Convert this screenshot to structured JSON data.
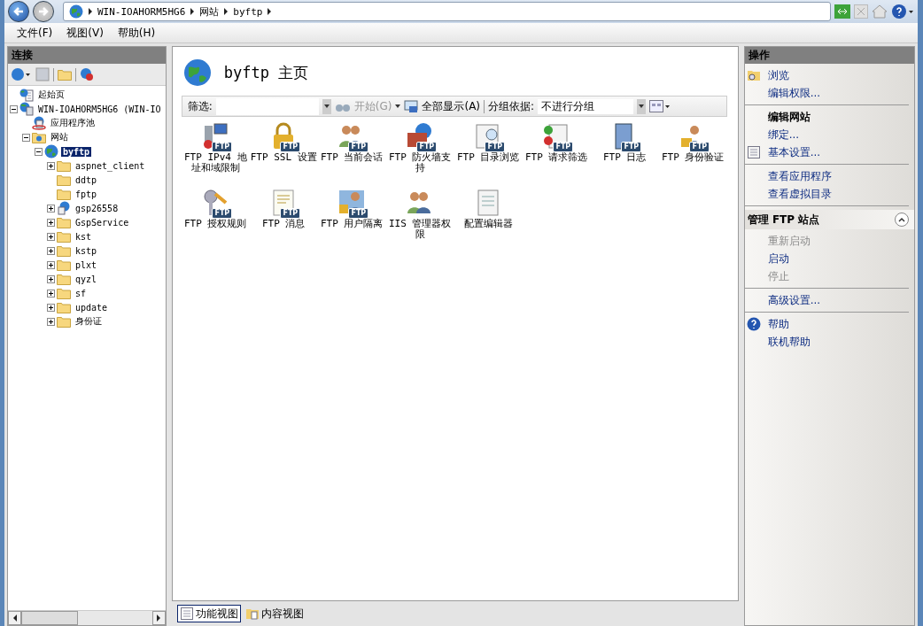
{
  "nav": {
    "breadcrumb": [
      "WIN-IOAHORM5HG6",
      "网站",
      "byftp"
    ]
  },
  "menu": [
    "文件(F)",
    "视图(V)",
    "帮助(H)"
  ],
  "connections": {
    "title": "连接",
    "tree": [
      {
        "label": "起始页",
        "kind": "home",
        "has_children": false,
        "selected": false
      },
      {
        "label": "WIN-IOAHORM5HG6 (WIN-IO",
        "kind": "server",
        "has_children": true,
        "expanded": true,
        "selected": false,
        "children": [
          {
            "label": "应用程序池",
            "kind": "pool",
            "has_children": false,
            "selected": false
          },
          {
            "label": "网站",
            "kind": "sites",
            "has_children": true,
            "expanded": true,
            "selected": false,
            "children": [
              {
                "label": "byftp",
                "kind": "site",
                "has_children": true,
                "expanded": true,
                "selected": true,
                "children": [
                  {
                    "label": "aspnet_client",
                    "kind": "folder",
                    "has_children": true,
                    "expanded": false,
                    "selected": false
                  },
                  {
                    "label": "ddtp",
                    "kind": "folder",
                    "has_children": false,
                    "selected": false
                  },
                  {
                    "label": "fptp",
                    "kind": "folder",
                    "has_children": false,
                    "selected": false
                  },
                  {
                    "label": "gsp26558",
                    "kind": "app",
                    "has_children": true,
                    "expanded": false,
                    "selected": false
                  },
                  {
                    "label": "GspService",
                    "kind": "folder",
                    "has_children": true,
                    "expanded": false,
                    "selected": false
                  },
                  {
                    "label": "kst",
                    "kind": "folder",
                    "has_children": true,
                    "expanded": false,
                    "selected": false
                  },
                  {
                    "label": "kstp",
                    "kind": "folder",
                    "has_children": true,
                    "expanded": false,
                    "selected": false
                  },
                  {
                    "label": "plxt",
                    "kind": "folder",
                    "has_children": true,
                    "expanded": false,
                    "selected": false
                  },
                  {
                    "label": "qyzl",
                    "kind": "folder",
                    "has_children": true,
                    "expanded": false,
                    "selected": false
                  },
                  {
                    "label": "sf",
                    "kind": "folder",
                    "has_children": true,
                    "expanded": false,
                    "selected": false
                  },
                  {
                    "label": "update",
                    "kind": "folder",
                    "has_children": true,
                    "expanded": false,
                    "selected": false
                  },
                  {
                    "label": "身份证",
                    "kind": "folder",
                    "has_children": true,
                    "expanded": false,
                    "selected": false
                  }
                ]
              }
            ]
          }
        ]
      }
    ]
  },
  "main": {
    "title": "byftp 主页",
    "filter": {
      "label": "筛选:",
      "go": "开始(G)",
      "show_all": "全部显示(A)",
      "group_label": "分组依据:",
      "group_value": "不进行分组"
    },
    "features": [
      {
        "label": "FTP IPv4 地址和域限制",
        "kind": "ipv4",
        "badge": "FTP"
      },
      {
        "label": "FTP SSL 设置",
        "kind": "lock",
        "badge": "FTP"
      },
      {
        "label": "FTP 当前会话",
        "kind": "users",
        "badge": "FTP"
      },
      {
        "label": "FTP 防火墙支持",
        "kind": "firewall",
        "badge": "FTP"
      },
      {
        "label": "FTP 目录浏览",
        "kind": "browse",
        "badge": "FTP"
      },
      {
        "label": "FTP 请求筛选",
        "kind": "filter",
        "badge": "FTP"
      },
      {
        "label": "FTP 日志",
        "kind": "log",
        "badge": "FTP"
      },
      {
        "label": "FTP 身份验证",
        "kind": "auth",
        "badge": "FTP"
      },
      {
        "label": "FTP 授权规则",
        "kind": "key",
        "badge": "FTP"
      },
      {
        "label": "FTP 消息",
        "kind": "message",
        "badge": "FTP"
      },
      {
        "label": "FTP 用户隔离",
        "kind": "isolation",
        "badge": "FTP"
      },
      {
        "label": "IIS 管理器权限",
        "kind": "users"
      },
      {
        "label": "配置编辑器",
        "kind": "editor"
      }
    ],
    "view_tabs": [
      {
        "label": "功能视图",
        "selected": true
      },
      {
        "label": "内容视图",
        "selected": false
      }
    ]
  },
  "actions": {
    "title": "操作",
    "sections": [
      {
        "groups": [
          [
            {
              "label": "浏览",
              "kind": "browse",
              "disabled": false
            },
            {
              "label": "编辑权限...",
              "kind": "link",
              "disabled": false
            }
          ],
          [
            {
              "label": "编辑网站",
              "kind": "heading",
              "disabled": false
            },
            {
              "label": "绑定...",
              "kind": "link",
              "disabled": false
            },
            {
              "label": "基本设置...",
              "kind": "settings",
              "disabled": false
            }
          ],
          [
            {
              "label": "查看应用程序",
              "kind": "link",
              "disabled": false
            },
            {
              "label": "查看虚拟目录",
              "kind": "link",
              "disabled": false
            }
          ]
        ]
      },
      {
        "title": "管理 FTP 站点",
        "expanded": true,
        "groups": [
          [
            {
              "label": "重新启动",
              "kind": "link",
              "disabled": true
            },
            {
              "label": "启动",
              "kind": "link",
              "disabled": false
            },
            {
              "label": "停止",
              "kind": "link",
              "disabled": true
            }
          ],
          [
            {
              "label": "高级设置...",
              "kind": "link",
              "disabled": false
            }
          ],
          [
            {
              "label": "帮助",
              "kind": "help",
              "disabled": false
            },
            {
              "label": "联机帮助",
              "kind": "link",
              "disabled": false
            }
          ]
        ]
      }
    ]
  }
}
